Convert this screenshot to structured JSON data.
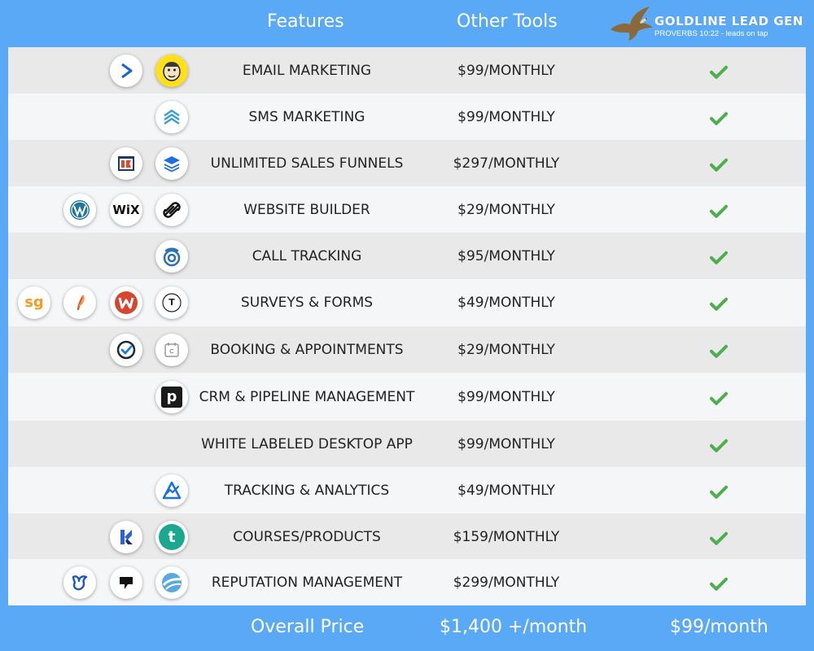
{
  "header": {
    "features_label": "Features",
    "other_tools_label": "Other Tools",
    "brand_name": "GOLDLINE LEAD GEN",
    "brand_tagline": "PROVERBS 10:22 - leads on tap"
  },
  "rows": [
    {
      "feature": "EMAIL MARKETING",
      "price": "$99/MONTHLY",
      "icons": [
        "activecampaign-icon",
        "mailchimp-icon"
      ]
    },
    {
      "feature": "SMS MARKETING",
      "price": "$99/MONTHLY",
      "icons": [
        "sms-stack-icon"
      ]
    },
    {
      "feature": "UNLIMITED SALES FUNNELS",
      "price": "$297/MONTHLY",
      "icons": [
        "clickfunnels-icon",
        "layers-icon"
      ]
    },
    {
      "feature": "WEBSITE BUILDER",
      "price": "$29/MONTHLY",
      "icons": [
        "wordpress-icon",
        "wix-icon",
        "squarespace-icon"
      ]
    },
    {
      "feature": "CALL TRACKING",
      "price": "$95/MONTHLY",
      "icons": [
        "call-tracking-icon"
      ]
    },
    {
      "feature": "SURVEYS & FORMS",
      "price": "$49/MONTHLY",
      "icons": [
        "surveygizmo-icon",
        "feather-icon",
        "wufoo-icon",
        "typeform-icon"
      ]
    },
    {
      "feature": "BOOKING & APPOINTMENTS",
      "price": "$29/MONTHLY",
      "icons": [
        "acuity-icon",
        "calendly-icon"
      ]
    },
    {
      "feature": "CRM & PIPELINE MANAGEMENT",
      "price": "$99/MONTHLY",
      "icons": [
        "pipedrive-icon"
      ]
    },
    {
      "feature": "WHITE LABELED DESKTOP APP",
      "price": "$99/MONTHLY",
      "icons": []
    },
    {
      "feature": "TRACKING & ANALYTICS",
      "price": "$49/MONTHLY",
      "icons": [
        "analytics-icon"
      ]
    },
    {
      "feature": "COURSES/PRODUCTS",
      "price": "$159/MONTHLY",
      "icons": [
        "kajabi-icon",
        "teachable-icon"
      ]
    },
    {
      "feature": "REPUTATION MANAGEMENT",
      "price": "$299/MONTHLY",
      "icons": [
        "birdeye-icon",
        "podium-icon",
        "reputation-icon"
      ]
    }
  ],
  "icon_text": {
    "wix": "WiX",
    "surveygizmo": "sg",
    "pipedrive": "p",
    "typeform": "T",
    "teachable": "t"
  },
  "footer": {
    "overall_label": "Overall Price",
    "other_total": "$1,400 +/month",
    "our_total": "$99/month"
  },
  "colors": {
    "background": "#5aa9f6",
    "row_alt": "#e9e9e9",
    "row_plain": "#f5f6f8",
    "check": "#4cae4c"
  }
}
